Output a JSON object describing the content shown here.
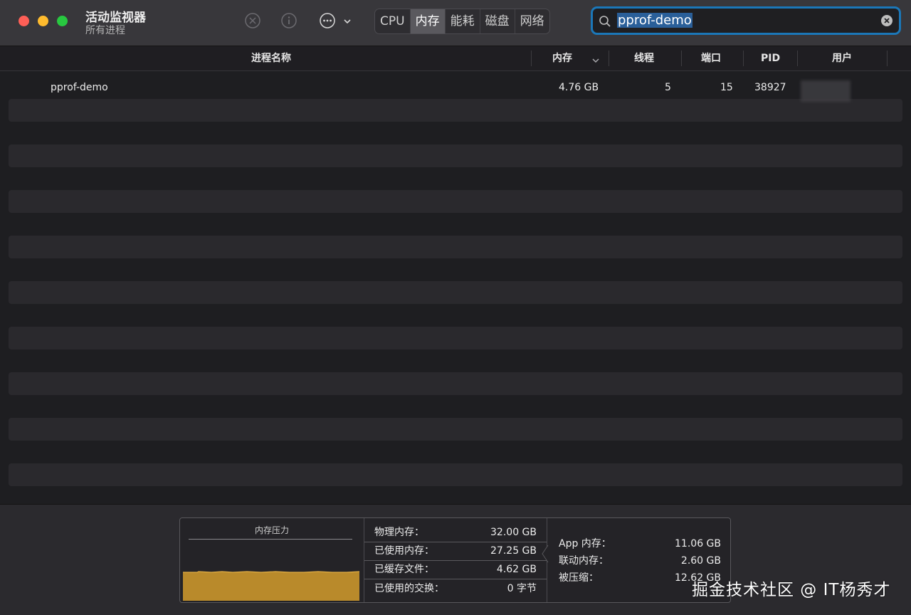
{
  "app": {
    "title": "活动监视器",
    "subtitle": "所有进程"
  },
  "toolbar": {
    "tabs": [
      {
        "label": "CPU",
        "active": false
      },
      {
        "label": "内存",
        "active": true
      },
      {
        "label": "能耗",
        "active": false
      },
      {
        "label": "磁盘",
        "active": false
      },
      {
        "label": "网络",
        "active": false
      }
    ],
    "icons": [
      "stop-process-icon",
      "info-icon",
      "more-icon",
      "chevron-down-icon"
    ]
  },
  "search": {
    "value": "pprof-demo"
  },
  "table": {
    "columns": [
      "进程名称",
      "内存",
      "线程",
      "端口",
      "PID",
      "用户"
    ],
    "sort_column": "内存",
    "rows": [
      {
        "name": "pprof-demo",
        "memory": "4.76 GB",
        "threads": "5",
        "ports": "15",
        "pid": "38927",
        "user": ""
      }
    ]
  },
  "memory_panel": {
    "pressure_title": "内存压力",
    "stats": [
      {
        "label": "物理内存：",
        "value": "32.00 GB"
      },
      {
        "label": "已使用内存：",
        "value": "27.25 GB"
      },
      {
        "label": "已缓存文件：",
        "value": "4.62 GB"
      },
      {
        "label": "已使用的交换：",
        "value": "0 字节"
      }
    ],
    "breakdown": [
      {
        "label": "App 内存：",
        "value": "11.06 GB"
      },
      {
        "label": "联动内存：",
        "value": "2.60 GB"
      },
      {
        "label": "被压缩：",
        "value": "12.62 GB"
      }
    ],
    "pressure_color": "#c8962e"
  },
  "watermark": "掘金技术社区 @ IT杨秀才",
  "colors": {
    "accent": "#1b77b8",
    "close": "#fe5f57",
    "minimize": "#febb2e",
    "zoom": "#28c840"
  }
}
